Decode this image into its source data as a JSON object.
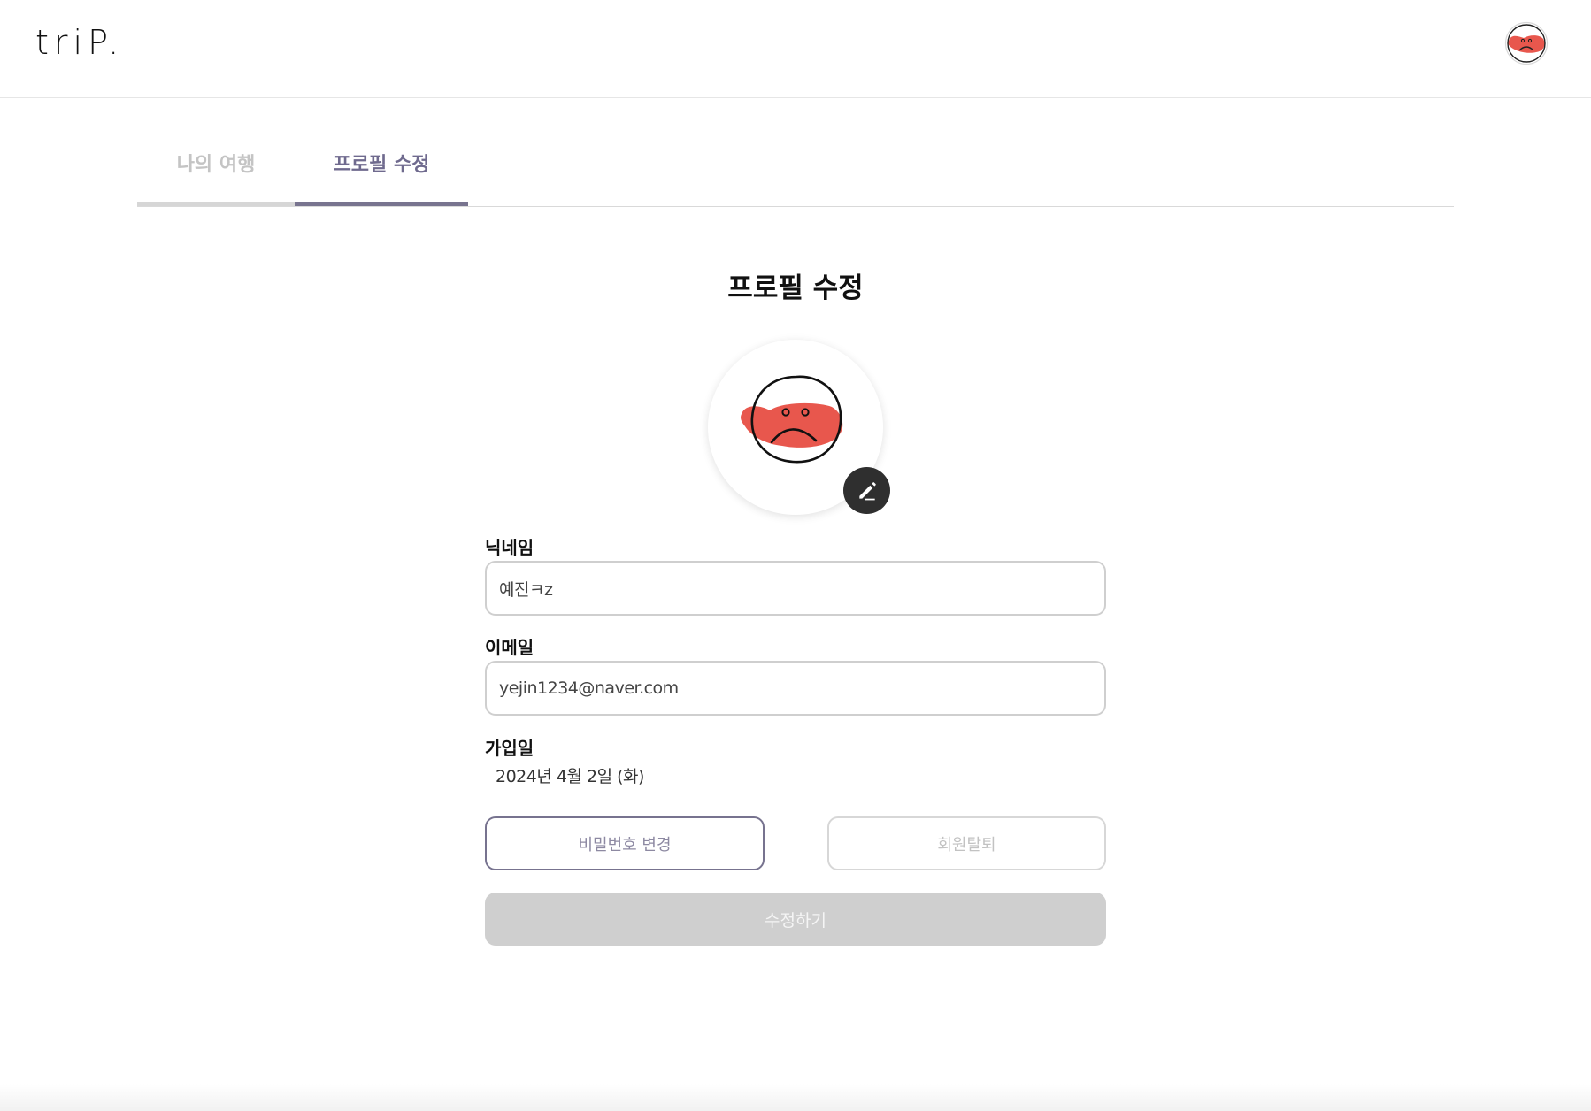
{
  "header": {
    "logo": "triP.",
    "avatar_icon": "sad-face-avatar-icon"
  },
  "tabs": [
    {
      "label": "나의 여행",
      "active": false
    },
    {
      "label": "프로필 수정",
      "active": true
    }
  ],
  "main": {
    "title": "프로필 수정",
    "avatar_icon": "sad-face-avatar-icon",
    "edit_icon": "pencil-icon",
    "nickname": {
      "label": "닉네임",
      "value": "예진ㅋz"
    },
    "email": {
      "label": "이메일",
      "value": "yejin1234@naver.com"
    },
    "join_date": {
      "label": "가입일",
      "value": "2024년 4월 2일 (화)"
    },
    "buttons": {
      "change_password": "비밀번호 변경",
      "withdraw": "회원탈퇴",
      "submit": "수정하기"
    }
  },
  "colors": {
    "accent": "#78748f",
    "avatar_red": "#e8574d",
    "submit_disabled": "#cfcfcf"
  }
}
